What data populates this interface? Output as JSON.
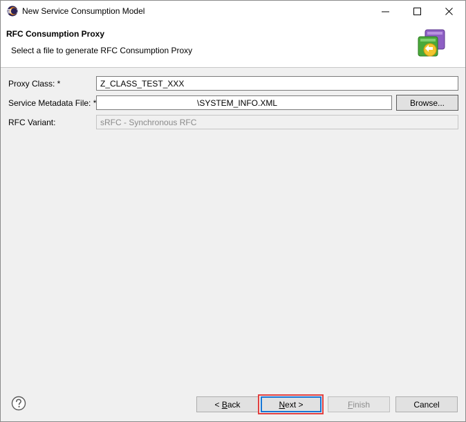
{
  "window": {
    "title": "New Service Consumption Model",
    "controls": {
      "minimize": "—",
      "maximize": "☐",
      "close": "✕"
    }
  },
  "banner": {
    "title": "RFC Consumption Proxy",
    "message": "Select a file to generate RFC Consumption Proxy",
    "graphic": "rfc-proxy-wizard-icon"
  },
  "form": {
    "proxy_class": {
      "label": "Proxy Class: *",
      "value": "Z_CLASS_TEST_XXX"
    },
    "metadata_file": {
      "label": "Service Metadata File: *",
      "value": "\\SYSTEM_INFO.XML",
      "browse_label": "Browse..."
    },
    "rfc_variant": {
      "label": "RFC Variant:",
      "value": "sRFC - Synchronous RFC"
    }
  },
  "footer": {
    "help_icon": "help-question-icon",
    "back": {
      "prefix": "< ",
      "mnemonic": "B",
      "rest": "ack"
    },
    "next": {
      "mnemonic": "N",
      "rest": "ext >"
    },
    "finish": {
      "mnemonic": "F",
      "rest": "inish"
    },
    "cancel": "Cancel"
  },
  "colors": {
    "highlight": "#e14040",
    "focus": "#1676d6"
  }
}
